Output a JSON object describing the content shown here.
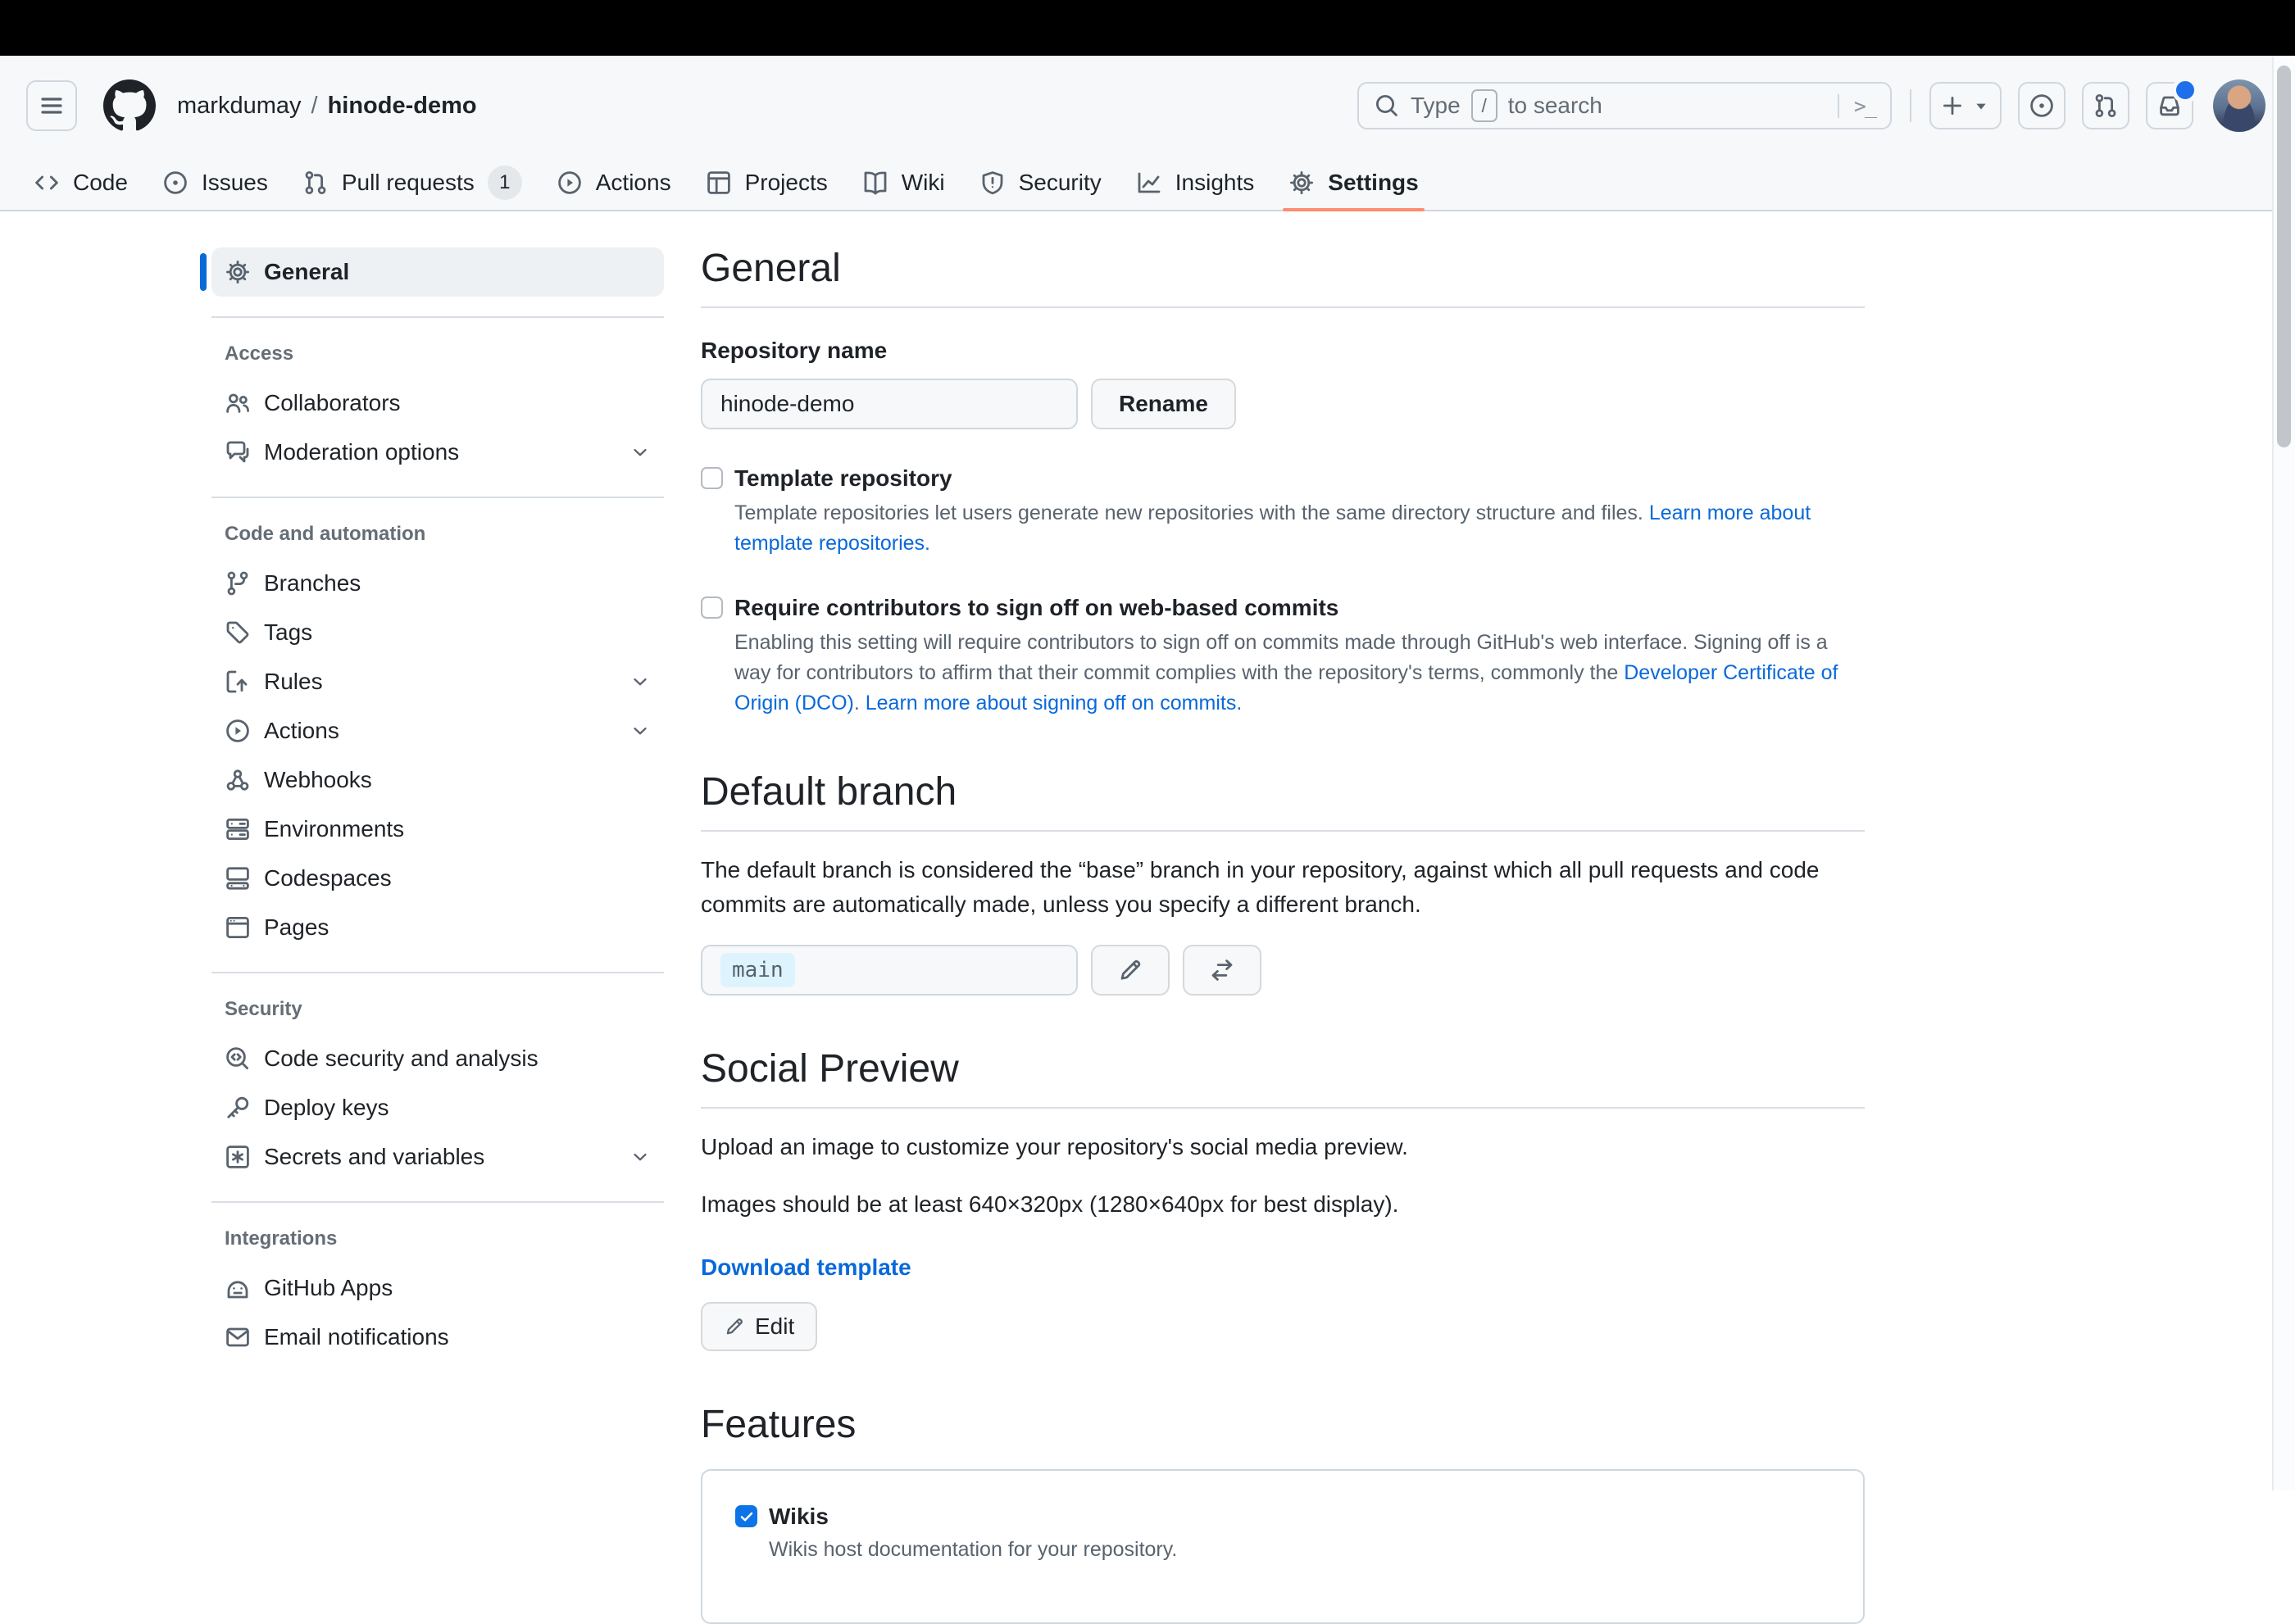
{
  "colors": {
    "accent_link_blue": "#0969da",
    "active_tab_underline": "#fd8c73",
    "header_background": "#f6f8fa",
    "border": "#d0d7de",
    "text_primary": "#1f2328",
    "text_secondary": "#656d76",
    "notification_dot_blue": "#1f6feb",
    "branch_token_background": "#ddf4ff",
    "checked_checkbox_blue": "#0d74e7",
    "sidebar_active_bar_blue": "#0969da"
  },
  "header": {
    "breadcrumb": {
      "owner": "markdumay",
      "separator": "/",
      "repo": "hinode-demo"
    },
    "search": {
      "text_before": "Type",
      "slash_key": "/",
      "text_after": "to search",
      "command_glyph": ">_"
    },
    "icons": {
      "hamburger": "three-bars",
      "github_logo": "octocat-mark",
      "search": "magnifier",
      "create_new": "plus-with-caret",
      "issues": "issue-opened",
      "pull_requests": "git-pull-request",
      "inbox": "inbox-with-unread-dot",
      "avatar": "user-photo"
    }
  },
  "tabs": {
    "items": [
      {
        "label": "Code",
        "icon": "code-icon"
      },
      {
        "label": "Issues",
        "icon": "issue-opened-icon"
      },
      {
        "label": "Pull requests",
        "icon": "git-pull-request-icon",
        "badge": "1"
      },
      {
        "label": "Actions",
        "icon": "play-icon"
      },
      {
        "label": "Projects",
        "icon": "table-icon"
      },
      {
        "label": "Wiki",
        "icon": "book-icon"
      },
      {
        "label": "Security",
        "icon": "shield-icon"
      },
      {
        "label": "Insights",
        "icon": "graph-icon"
      },
      {
        "label": "Settings",
        "icon": "gear-icon",
        "active": true
      }
    ]
  },
  "sidebar": {
    "sections": [
      {
        "title": "",
        "items": [
          {
            "label": "General",
            "icon": "gear-icon",
            "active": true
          }
        ]
      },
      {
        "title": "Access",
        "items": [
          {
            "label": "Collaborators",
            "icon": "people-icon"
          },
          {
            "label": "Moderation options",
            "icon": "comment-discussion-icon",
            "expandable": true
          }
        ]
      },
      {
        "title": "Code and automation",
        "items": [
          {
            "label": "Branches",
            "icon": "git-branch-icon"
          },
          {
            "label": "Tags",
            "icon": "tag-icon"
          },
          {
            "label": "Rules",
            "icon": "rules-icon",
            "expandable": true
          },
          {
            "label": "Actions",
            "icon": "play-icon",
            "expandable": true
          },
          {
            "label": "Webhooks",
            "icon": "webhook-icon"
          },
          {
            "label": "Environments",
            "icon": "server-icon"
          },
          {
            "label": "Codespaces",
            "icon": "codespaces-icon"
          },
          {
            "label": "Pages",
            "icon": "browser-icon"
          }
        ]
      },
      {
        "title": "Security",
        "items": [
          {
            "label": "Code security and analysis",
            "icon": "codescan-icon"
          },
          {
            "label": "Deploy keys",
            "icon": "key-icon"
          },
          {
            "label": "Secrets and variables",
            "icon": "secret-icon",
            "expandable": true
          }
        ]
      },
      {
        "title": "Integrations",
        "items": [
          {
            "label": "GitHub Apps",
            "icon": "hubot-icon"
          },
          {
            "label": "Email notifications",
            "icon": "mail-icon"
          }
        ]
      }
    ]
  },
  "main": {
    "general": {
      "heading": "General",
      "repository_name": {
        "label": "Repository name",
        "value": "hinode-demo",
        "rename_button": "Rename"
      },
      "template_repository": {
        "label": "Template repository",
        "checked": false,
        "description": "Template repositories let users generate new repositories with the same directory structure and files.",
        "link": "Learn more about template repositories."
      },
      "signoff": {
        "label": "Require contributors to sign off on web-based commits",
        "checked": false,
        "description_part1": "Enabling this setting will require contributors to sign off on commits made through GitHub's web interface. Signing off is a way for contributors to affirm that their commit complies with the repository's terms, commonly the ",
        "dco_link": "Developer Certificate of Origin (DCO)",
        "description_part2": ". ",
        "learn_link": "Learn more about signing off on commits."
      }
    },
    "default_branch": {
      "heading": "Default branch",
      "description": "The default branch is considered the “base” branch in your repository, against which all pull requests and code commits are automatically made, unless you specify a different branch.",
      "branch_value": "main"
    },
    "social_preview": {
      "heading": "Social Preview",
      "line1": "Upload an image to customize your repository's social media preview.",
      "line2": "Images should be at least 640×320px (1280×640px for best display).",
      "download_link": "Download template",
      "edit_button": "Edit"
    },
    "features": {
      "heading": "Features",
      "wikis": {
        "label": "Wikis",
        "checked": true,
        "description": "Wikis host documentation for your repository."
      }
    }
  }
}
